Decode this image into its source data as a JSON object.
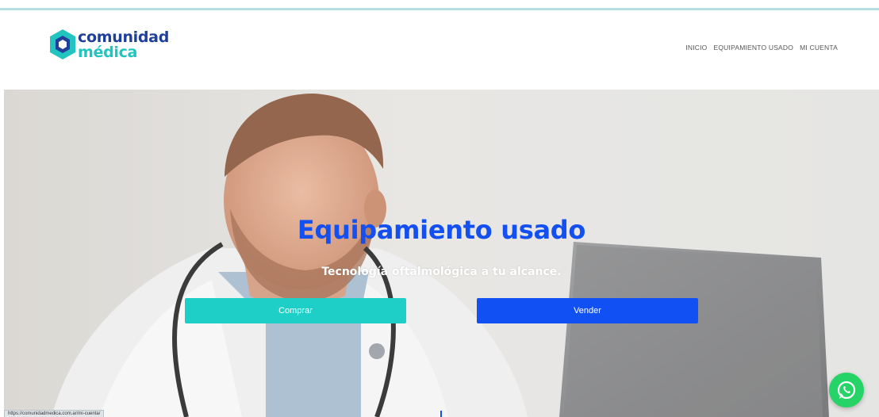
{
  "logo": {
    "line1": "comunidad",
    "line2": "médica"
  },
  "nav": {
    "items": [
      {
        "label": "INICIO"
      },
      {
        "label": "EQUIPAMIENTO USADO"
      },
      {
        "label": "MI CUENTA"
      }
    ]
  },
  "hero": {
    "title": "Equipamiento usado",
    "subtitle": "Tecnología oftalmológica a tu alcance.",
    "buttons": {
      "buy_label": "Comprar",
      "sell_label": "Vender"
    }
  },
  "status_bar": {
    "url": "https://comunidadmedica.com.ar/mi-cuenta/"
  },
  "colors": {
    "brand_dark": "#1e3f9a",
    "brand_teal": "#22c4c0",
    "title_blue": "#1450f0",
    "buy_button": "#1ecfc8",
    "sell_button": "#1150f2",
    "whatsapp": "#25d366"
  },
  "icons": {
    "logo": "hexagon-logo-icon",
    "whatsapp": "whatsapp-icon"
  }
}
